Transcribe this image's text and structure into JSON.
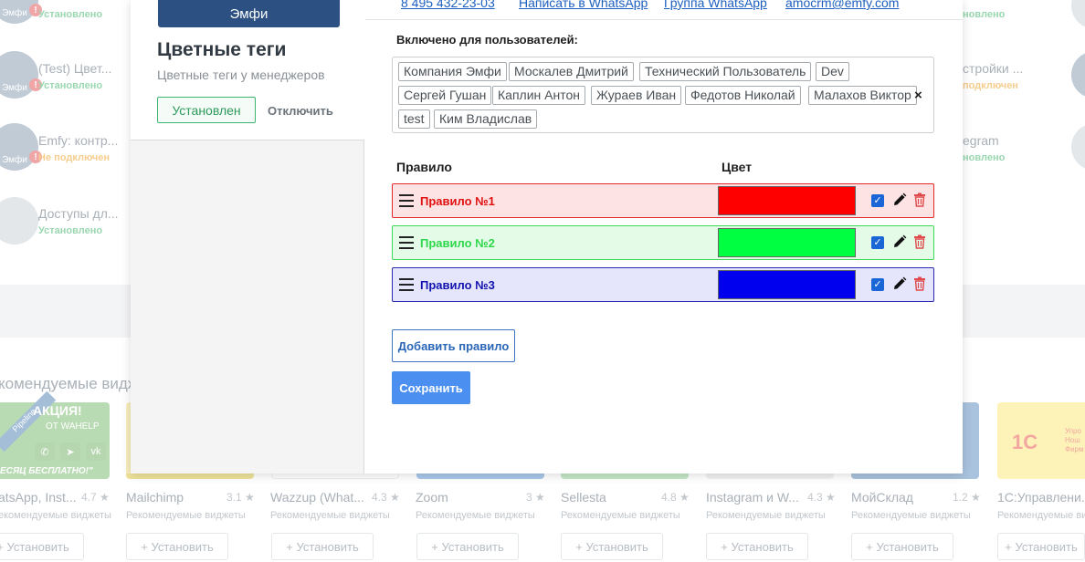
{
  "background": {
    "left_items": [
      {
        "title": "",
        "status": "Установлено",
        "status_kind": "ok",
        "logo_text": "Эмфи"
      },
      {
        "title": "(Test) Цвет...",
        "status": "Установлено",
        "status_kind": "ok",
        "logo_text": "Эмфи"
      },
      {
        "title": "Emfy: контр...",
        "status": "Не подключен",
        "status_kind": "warn",
        "logo_text": "Эмфи"
      },
      {
        "title": "Доступы дл...",
        "status": "Установлено",
        "status_kind": "ok",
        "logo_text": ""
      }
    ],
    "right_items": [
      {
        "title": "стройки ...",
        "status": "подключен",
        "status_kind": "warn"
      },
      {
        "title": "egram",
        "status": "новлено",
        "status_kind": "ok"
      },
      {
        "title": "",
        "status": "новлено",
        "status_kind": "ok"
      }
    ],
    "recommended_title": "комендуемые видж",
    "promo": {
      "line1": "АКЦИЯ!",
      "line2": "ОТ WAHELP",
      "line3": "ЕСЯЦ БЕСПЛАТНО!\"",
      "ribbon": "Pipeline"
    },
    "onec": {
      "logo": "1С",
      "side": "Упро\nНош\nФирм"
    },
    "cards": [
      {
        "name": "atsApp, Inst...",
        "rating": "4.7 ★",
        "sub": "екомендуемые виджеты",
        "install": "+ Установить"
      },
      {
        "name": "Mailchimp",
        "rating": "3.1 ★",
        "sub": "Рекомендуемые виджеты",
        "install": "+ Установить"
      },
      {
        "name": "Wazzup (What...",
        "rating": "4.3 ★",
        "sub": "Рекомендуемые виджеты",
        "install": "+ Установить"
      },
      {
        "name": "Zoom",
        "rating": "3 ★",
        "sub": "Рекомендуемые виджеты",
        "install": "+ Установить"
      },
      {
        "name": "Sellesta",
        "rating": "4.8 ★",
        "sub": "Рекомендуемые виджеты",
        "install": "+ Установить"
      },
      {
        "name": "Instagram и W...",
        "rating": "4.3 ★",
        "sub": "Рекомендуемые виджеты",
        "install": "+ Установить"
      },
      {
        "name": "МойСклад",
        "rating": "1.2 ★",
        "sub": "Рекомендуемые виджеты",
        "install": "+ Установить"
      },
      {
        "name": "1С:Управлени...",
        "rating": "",
        "sub": "Рекомендуемые виджеты",
        "install": "+ Установить"
      }
    ]
  },
  "modal": {
    "side": {
      "logo_text": "Эмфи",
      "title": "Цветные теги",
      "subtitle": "Цветные теги у менеджеров",
      "installed_label": "Установлен",
      "disable_label": "Отключить"
    },
    "contacts": {
      "phone": "8 495 432-23-03",
      "whatsapp": "Написать в WhatsApp",
      "group": "Группа WhatsApp",
      "email": "amocrm@emfy.com"
    },
    "users_label": "Включено для пользователей:",
    "users": [
      "Компания Эмфи",
      "Москалев Дмитрий",
      "Технический Пользователь",
      "Dev",
      "Сергей Гушан",
      "Каплин Антон",
      "Жураев Иван",
      "Федотов Николай",
      "Малахов Виктор",
      "test",
      "Ким Владислав"
    ],
    "clear_glyph": "×",
    "columns": {
      "rule": "Правило",
      "color": "Цвет"
    },
    "rules": [
      {
        "name": "Правило №1",
        "color": "#ff0000",
        "text_color": "#e01010",
        "row_bg": "#fde3e3",
        "row_border": "#e0282d",
        "enabled": true
      },
      {
        "name": "Правило №2",
        "color": "#00ff40",
        "text_color": "#2ed84a",
        "row_bg": "#e4fbe8",
        "row_border": "#3dd858",
        "enabled": true
      },
      {
        "name": "Правило №3",
        "color": "#0000ee",
        "text_color": "#1212b0",
        "row_bg": "#e5e5fb",
        "row_border": "#2a2ab0",
        "enabled": true
      }
    ],
    "check_glyph": "✓",
    "add_rule_label": "Добавить правило",
    "save_label": "Сохранить"
  }
}
